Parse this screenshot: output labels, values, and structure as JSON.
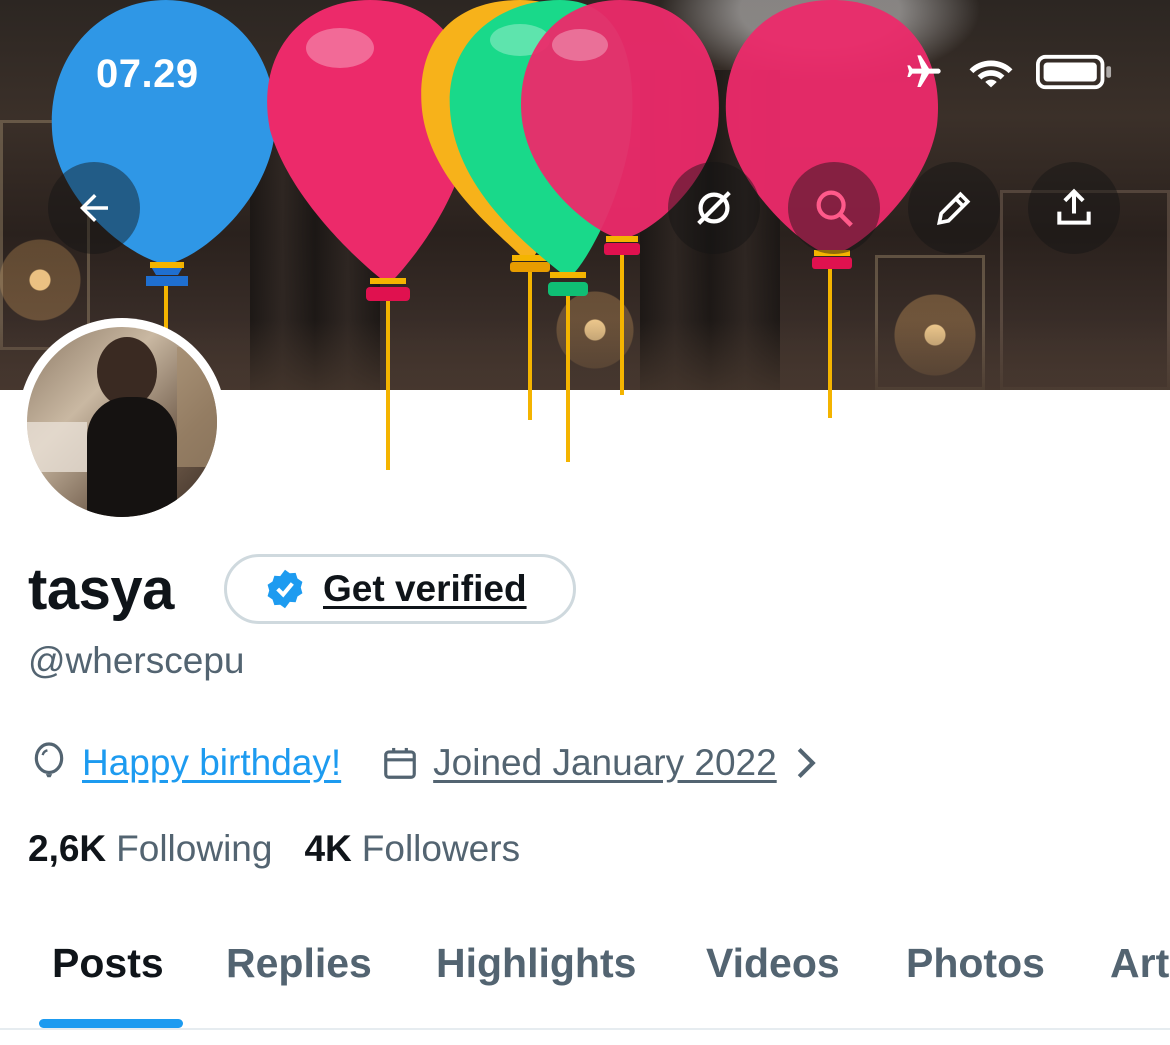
{
  "status_bar": {
    "time": "07.29",
    "icons": [
      "airplane-icon",
      "wifi-icon",
      "battery-icon"
    ]
  },
  "header_actions": {
    "back": "back-arrow-icon",
    "right": [
      "translate-off-icon",
      "search-icon",
      "edit-pencil-icon",
      "share-icon"
    ]
  },
  "profile": {
    "name": "tasya",
    "verify_label": "Get verified",
    "handle": "@wherscepu",
    "birthday_text": "Happy birthday!",
    "joined_text": "Joined January 2022",
    "following_count": "2,6K",
    "following_label": "Following",
    "followers_count": "4K",
    "followers_label": "Followers"
  },
  "tabs": [
    {
      "label": "Posts",
      "active": true
    },
    {
      "label": "Replies",
      "active": false
    },
    {
      "label": "Highlights",
      "active": false
    },
    {
      "label": "Videos",
      "active": false
    },
    {
      "label": "Photos",
      "active": false
    },
    {
      "label": "Art",
      "active": false
    }
  ],
  "colors": {
    "accent": "#1d9bf0",
    "text_primary": "#0f1419",
    "text_secondary": "#536471",
    "balloon_blue": "#2f97e6",
    "balloon_pink": "#ec2a6a",
    "balloon_yellow": "#f7b21a",
    "balloon_green": "#19d98a"
  }
}
